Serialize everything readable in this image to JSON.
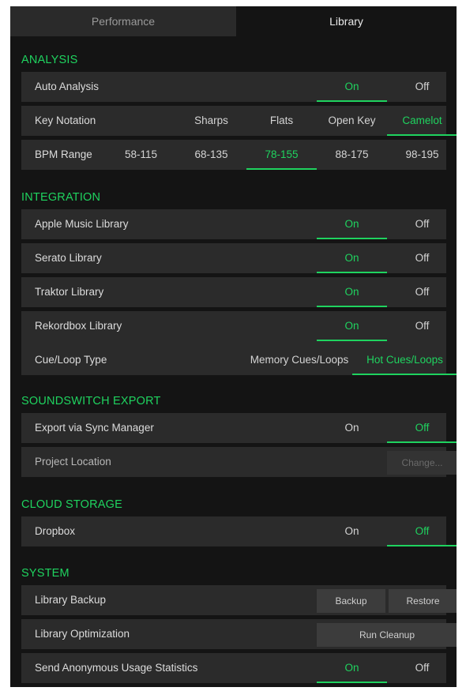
{
  "tabs": [
    {
      "label": "Performance",
      "active": false
    },
    {
      "label": "Library",
      "active": true
    }
  ],
  "accent_color": "#1fd35f",
  "sections": {
    "analysis": {
      "title": "ANALYSIS",
      "auto_analysis": {
        "label": "Auto Analysis",
        "on": "On",
        "off": "Off",
        "selected": "On"
      },
      "key_notation": {
        "label": "Key Notation",
        "options": [
          "Sharps",
          "Flats",
          "Open Key",
          "Camelot"
        ],
        "selected": "Camelot"
      },
      "bpm_range": {
        "label": "BPM Range",
        "options": [
          "58-115",
          "68-135",
          "78-155",
          "88-175",
          "98-195"
        ],
        "selected": "78-155"
      }
    },
    "integration": {
      "title": "INTEGRATION",
      "apple_music": {
        "label": "Apple Music Library",
        "on": "On",
        "off": "Off",
        "selected": "On"
      },
      "serato": {
        "label": "Serato Library",
        "on": "On",
        "off": "Off",
        "selected": "On"
      },
      "traktor": {
        "label": "Traktor Library",
        "on": "On",
        "off": "Off",
        "selected": "On"
      },
      "rekordbox": {
        "label": "Rekordbox Library",
        "on": "On",
        "off": "Off",
        "selected": "On"
      },
      "cue_loop": {
        "label": "Cue/Loop Type",
        "options": [
          "Memory Cues/Loops",
          "Hot Cues/Loops"
        ],
        "selected": "Hot Cues/Loops"
      }
    },
    "soundswitch": {
      "title": "SOUNDSWITCH EXPORT",
      "export_sync": {
        "label": "Export via Sync Manager",
        "on": "On",
        "off": "Off",
        "selected": "Off"
      },
      "project_location": {
        "label": "Project Location",
        "button": "Change..."
      }
    },
    "cloud": {
      "title": "CLOUD STORAGE",
      "dropbox": {
        "label": "Dropbox",
        "on": "On",
        "off": "Off",
        "selected": "Off"
      }
    },
    "system": {
      "title": "SYSTEM",
      "backup": {
        "label": "Library Backup",
        "backup_button": "Backup",
        "restore_button": "Restore"
      },
      "optimization": {
        "label": "Library Optimization",
        "button": "Run Cleanup"
      },
      "usage_stats": {
        "label": "Send Anonymous Usage Statistics",
        "on": "On",
        "off": "Off",
        "selected": "On"
      }
    }
  }
}
